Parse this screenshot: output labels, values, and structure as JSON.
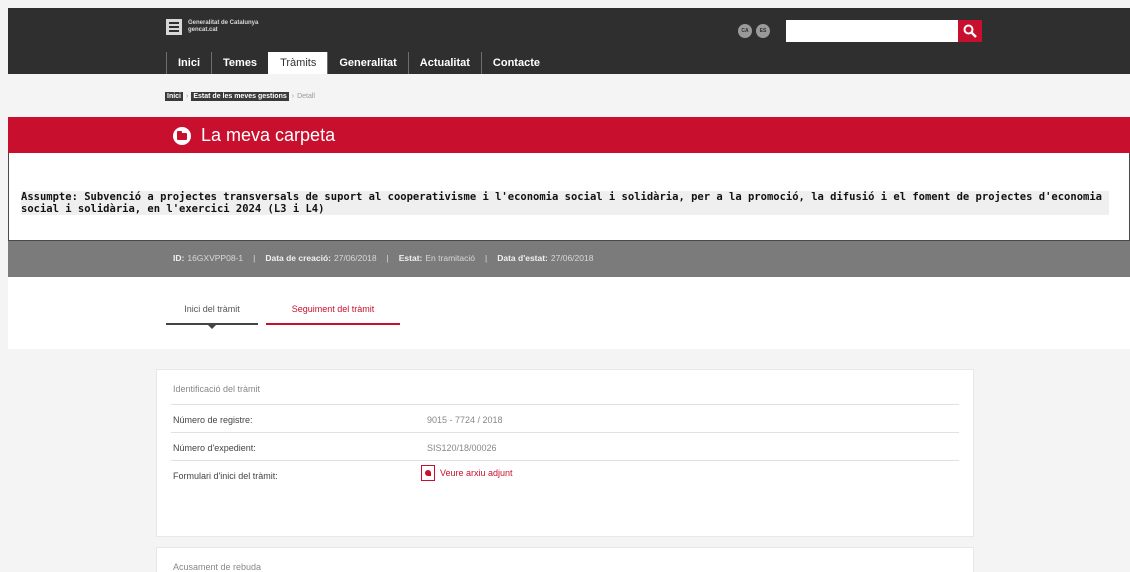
{
  "header": {
    "logo_line1": "Generalitat de Catalunya",
    "logo_line2": "gencat.cat",
    "lang_ca": "CA",
    "lang_es": "ES",
    "search_value": "",
    "nav": [
      {
        "label": "Inici"
      },
      {
        "label": "Temes"
      },
      {
        "label": "Tràmits"
      },
      {
        "label": "Generalitat"
      },
      {
        "label": "Actualitat"
      },
      {
        "label": "Contacte"
      }
    ],
    "active_nav": "Tràmits"
  },
  "breadcrumb": {
    "home": "Inici",
    "parent": "Estat de les meves gestions",
    "current": "Detall"
  },
  "title": "La meva carpeta",
  "subject": "Assumpte: Subvenció a projectes transversals de suport al cooperativisme i l'economia social i solidària, per a la promoció, la difusió i el foment de projectes d'economia social i solidària, en l'exercici 2024 (L3 i L4)",
  "meta": {
    "id_label": "ID:",
    "id_value": "16GXVPP08-1",
    "created_label": "Data de creació:",
    "created_value": "27/06/2018",
    "status_label": "Estat:",
    "status_value": "En tramitació",
    "status_date_label": "Data d'estat:",
    "status_date_value": "27/06/2018"
  },
  "tabs": [
    {
      "label": "Inici del tràmit"
    },
    {
      "label": "Seguiment del tràmit"
    }
  ],
  "card": {
    "title": "Identificació del tràmit",
    "rows": [
      {
        "label": "Número de registre:",
        "value": "9015 - 7724 / 2018"
      },
      {
        "label": "Número d'expedient:",
        "value": "SIS120/18/00026"
      },
      {
        "label": "Formulari d'inici del tràmit:",
        "value": "Veure arxiu adjunt"
      }
    ]
  },
  "card2": {
    "title": "Acusament de rebuda"
  },
  "colors": {
    "brand_red": "#c8102e",
    "header_dark": "#2f2f2f",
    "meta_grey": "#7b7b7b"
  }
}
